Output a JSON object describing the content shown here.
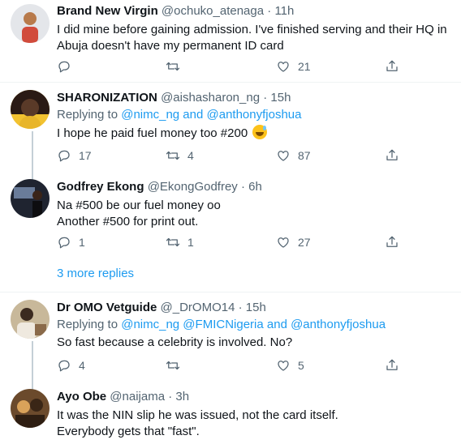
{
  "tweets": [
    {
      "name": "Brand New Virgin",
      "handle": "@ochuko_atenaga",
      "time": "11h",
      "replying_prefix": "",
      "replying_to": "",
      "lines": [
        "I did mine before gaining admission. I've finished serving and their HQ in",
        "Abuja doesn't have my permanent ID card"
      ],
      "replies": "",
      "retweets": "",
      "likes": "21",
      "avatar_colors": [
        "#e4e6ea",
        "#d14b3c"
      ]
    },
    {
      "name": "SHARONIZATION",
      "handle": "@aishasharon_ng",
      "time": "15h",
      "replying_prefix": "Replying to",
      "replying_to": "@nimc_ng and @anthonyfjoshua",
      "lines": [
        "I hope he paid fuel money too #200"
      ],
      "emoji": "grinning-sweat-emoji",
      "replies": "17",
      "retweets": "4",
      "likes": "87",
      "avatar_colors": [
        "#2a1a14",
        "#f2c230"
      ]
    },
    {
      "name": "Godfrey Ekong",
      "handle": "@EkongGodfrey",
      "time": "6h",
      "replying_prefix": "",
      "replying_to": "",
      "lines": [
        "Na #500 be our fuel money oo",
        "Another #500 for print out."
      ],
      "replies": "1",
      "retweets": "1",
      "likes": "27",
      "avatar_colors": [
        "#1f2430",
        "#6a7c99"
      ]
    },
    {
      "name": "Dr OMO Vetguide",
      "handle": "@_DrOMO14",
      "time": "15h",
      "replying_prefix": "Replying to",
      "replying_to": "@nimc_ng @FMICNigeria and @anthonyfjoshua",
      "lines": [
        "So fast because a celebrity is involved. No?"
      ],
      "replies": "4",
      "retweets": "",
      "likes": "5",
      "avatar_colors": [
        "#c8b89a",
        "#3b2a20"
      ]
    },
    {
      "name": "Ayo Obe",
      "handle": "@naijama",
      "time": "3h",
      "replying_prefix": "",
      "replying_to": "",
      "lines": [
        "It was the NIN slip he was issued, not the card itself.",
        "Everybody gets that \"fast\"."
      ],
      "avatar_colors": [
        "#6b4a2c",
        "#d9a25a"
      ]
    }
  ],
  "more_replies": "3 more replies",
  "dot": "·",
  "colors": {
    "accent": "#1d9bf0",
    "secondary_text": "#536471",
    "divider": "#eff3f4"
  }
}
